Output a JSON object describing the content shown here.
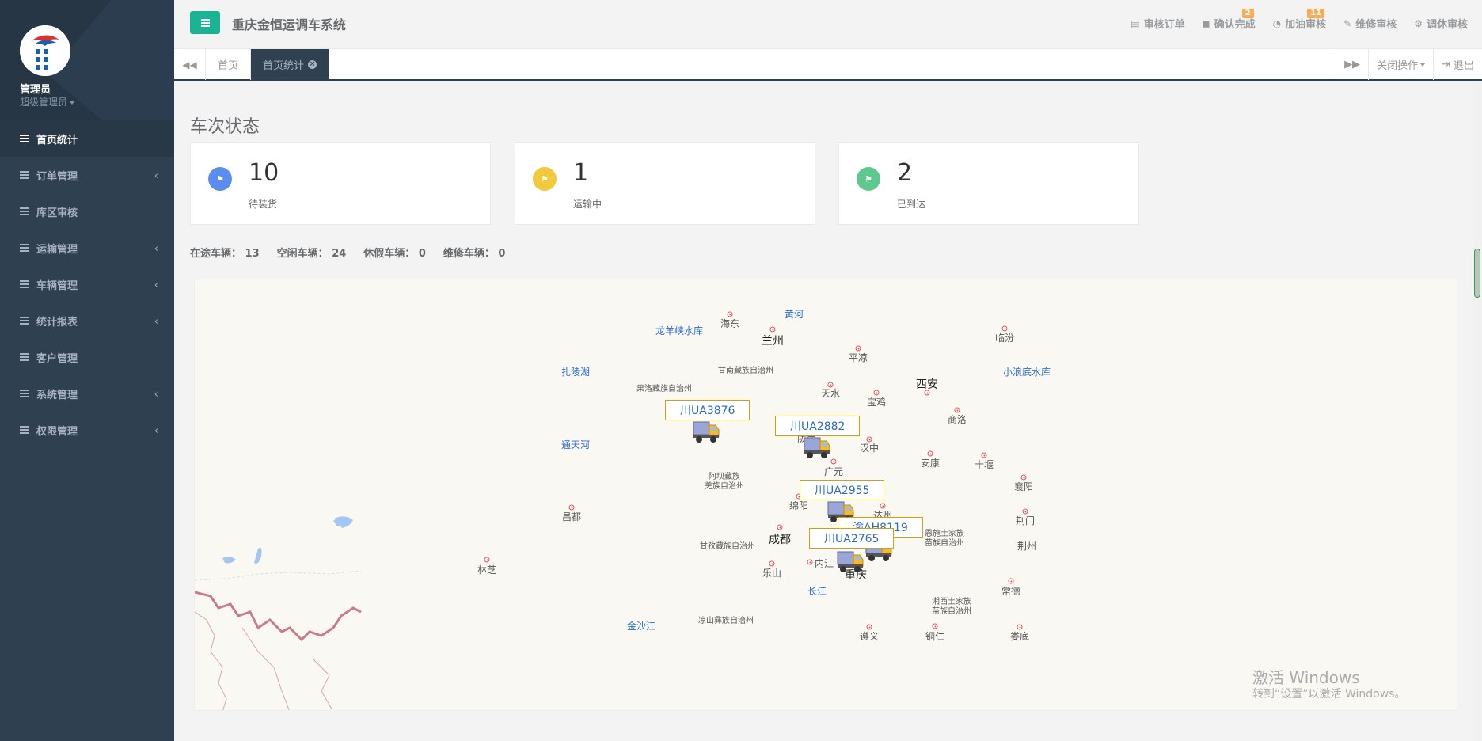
{
  "sidebar": {
    "user_name": "管理员",
    "user_role": "超级管理员",
    "items": [
      {
        "label": "首页统计",
        "active": true,
        "has_sub": false
      },
      {
        "label": "订单管理",
        "active": false,
        "has_sub": true
      },
      {
        "label": "库区审核",
        "active": false,
        "has_sub": false
      },
      {
        "label": "运输管理",
        "active": false,
        "has_sub": true
      },
      {
        "label": "车辆管理",
        "active": false,
        "has_sub": true
      },
      {
        "label": "统计报表",
        "active": false,
        "has_sub": true
      },
      {
        "label": "客户管理",
        "active": false,
        "has_sub": false
      },
      {
        "label": "系统管理",
        "active": false,
        "has_sub": true
      },
      {
        "label": "权限管理",
        "active": false,
        "has_sub": true
      }
    ]
  },
  "header": {
    "title": "重庆金恒运调车系统",
    "nav": [
      {
        "label": "审核订单",
        "icon": "file-icon",
        "badge": ""
      },
      {
        "label": "确认完成",
        "icon": "car-icon",
        "badge": "2"
      },
      {
        "label": "加油审核",
        "icon": "gauge-icon",
        "badge": "11"
      },
      {
        "label": "维修审核",
        "icon": "wrench-icon",
        "badge": ""
      },
      {
        "label": "调休审核",
        "icon": "gears-icon",
        "badge": ""
      }
    ]
  },
  "tabs": {
    "items": [
      {
        "label": "首页",
        "active": false
      },
      {
        "label": "首页统计",
        "active": true
      }
    ],
    "close_ops": "关闭操作",
    "logout": "退出"
  },
  "main": {
    "section_title": "车次状态",
    "stats": [
      {
        "value": "10",
        "label": "待装货",
        "color": "#5b8def"
      },
      {
        "value": "1",
        "label": "运输中",
        "color": "#f0c93e"
      },
      {
        "value": "2",
        "label": "已到达",
        "color": "#5fc88f"
      }
    ],
    "vehicle_counts": [
      {
        "label": "在途车辆：",
        "value": "13"
      },
      {
        "label": "空闲车辆：",
        "value": "24"
      },
      {
        "label": "休假车辆：",
        "value": "0"
      },
      {
        "label": "维修车辆：",
        "value": "0"
      }
    ]
  },
  "map": {
    "cities": [
      {
        "name": "海东",
        "type": "city"
      },
      {
        "name": "黄河",
        "type": "water"
      },
      {
        "name": "龙羊峡水库",
        "type": "water"
      },
      {
        "name": "兰州",
        "type": "big"
      },
      {
        "name": "临汾",
        "type": "city"
      },
      {
        "name": "平凉",
        "type": "city"
      },
      {
        "name": "扎陵湖",
        "type": "water"
      },
      {
        "name": "甘南藏族自治州",
        "type": "small"
      },
      {
        "name": "小浪底水库",
        "type": "water"
      },
      {
        "name": "果洛藏族自治州",
        "type": "small"
      },
      {
        "name": "天水",
        "type": "city"
      },
      {
        "name": "西安",
        "type": "big"
      },
      {
        "name": "宝鸡",
        "type": "city"
      },
      {
        "name": "商洛",
        "type": "city"
      },
      {
        "name": "陇南",
        "type": "city"
      },
      {
        "name": "汉中",
        "type": "city"
      },
      {
        "name": "通天河",
        "type": "water"
      },
      {
        "name": "安康",
        "type": "city"
      },
      {
        "name": "十堰",
        "type": "city"
      },
      {
        "name": "广元",
        "type": "city"
      },
      {
        "name": "阿坝藏族",
        "type": "small"
      },
      {
        "name": "羌族自治州",
        "type": "small"
      },
      {
        "name": "襄阳",
        "type": "city"
      },
      {
        "name": "绵阳",
        "type": "city"
      },
      {
        "name": "达州",
        "type": "city"
      },
      {
        "name": "昌都",
        "type": "city"
      },
      {
        "name": "荆门",
        "type": "city"
      },
      {
        "name": "恩施土家族",
        "type": "small"
      },
      {
        "name": "苗族自治州",
        "type": "small"
      },
      {
        "name": "成都",
        "type": "big"
      },
      {
        "name": "甘孜藏族自治州",
        "type": "small"
      },
      {
        "name": "荆州",
        "type": "city"
      },
      {
        "name": "内江",
        "type": "city"
      },
      {
        "name": "重庆",
        "type": "big"
      },
      {
        "name": "林芝",
        "type": "city"
      },
      {
        "name": "乐山",
        "type": "city"
      },
      {
        "name": "长江",
        "type": "water"
      },
      {
        "name": "常德",
        "type": "city"
      },
      {
        "name": "湘西土家族",
        "type": "small"
      },
      {
        "name": "苗族自治州",
        "type": "small"
      },
      {
        "name": "金沙江",
        "type": "water"
      },
      {
        "name": "凉山彝族自治州",
        "type": "small"
      },
      {
        "name": "遵义",
        "type": "city"
      },
      {
        "name": "铜仁",
        "type": "city"
      },
      {
        "name": "娄底",
        "type": "city"
      }
    ],
    "trucks": [
      {
        "plate": "川UA3876"
      },
      {
        "plate": "川UA2882"
      },
      {
        "plate": "川UA2955"
      },
      {
        "plate": "渝AH8119"
      },
      {
        "plate": "川UA2765"
      }
    ]
  },
  "watermark": {
    "line1": "激活 Windows",
    "line2": "转到“设置”以激活 Windows。"
  }
}
